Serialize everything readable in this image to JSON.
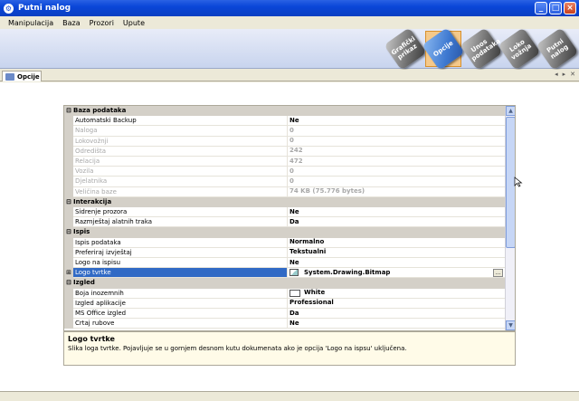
{
  "window": {
    "title": "Putni nalog"
  },
  "menu": [
    "Manipulacija",
    "Baza",
    "Prozori",
    "Upute"
  ],
  "toolbar": {
    "buttons": [
      {
        "label": "Grafički prikaz",
        "icon": "chart-icon",
        "active": false
      },
      {
        "label": "Opcije",
        "icon": "options-icon",
        "active": true
      },
      {
        "label": "Unos podataka",
        "icon": "data-entry-icon",
        "active": false
      },
      {
        "label": "Loko vožnja",
        "icon": "local-drive-icon",
        "active": false
      },
      {
        "label": "Putni nalog",
        "icon": "travel-order-icon",
        "active": false
      }
    ]
  },
  "doc_tab": {
    "label": "Opcije"
  },
  "grid": {
    "rows": [
      {
        "kind": "cat",
        "name": "Baza podataka",
        "expander": "⊟"
      },
      {
        "kind": "prop",
        "name": "Automatski Backup",
        "value": "Ne"
      },
      {
        "kind": "dis",
        "name": "Naloga",
        "value": "0"
      },
      {
        "kind": "dis",
        "name": "Lokovožnji",
        "value": "0"
      },
      {
        "kind": "dis",
        "name": "Odredišta",
        "value": "242"
      },
      {
        "kind": "dis",
        "name": "Relacija",
        "value": "472"
      },
      {
        "kind": "dis",
        "name": "Vozila",
        "value": "0"
      },
      {
        "kind": "dis",
        "name": "Djelatnika",
        "value": "0"
      },
      {
        "kind": "dis",
        "name": "Veličina baze",
        "value": "74 KB (75.776 bytes)"
      },
      {
        "kind": "cat",
        "name": "Interakcija",
        "expander": "⊟"
      },
      {
        "kind": "prop",
        "name": "Sidrenje prozora",
        "value": "Ne"
      },
      {
        "kind": "prop",
        "name": "Razmještaj alatnih traka",
        "value": "Da"
      },
      {
        "kind": "cat",
        "name": "Ispis",
        "expander": "⊟"
      },
      {
        "kind": "prop",
        "name": "Ispis podataka",
        "value": "Normalno"
      },
      {
        "kind": "prop",
        "name": "Preferiraj izvještaj",
        "value": "Tekstualni"
      },
      {
        "kind": "prop",
        "name": "Logo na ispisu",
        "value": "Ne"
      },
      {
        "kind": "sel",
        "name": "Logo tvrtke",
        "value": "System.Drawing.Bitmap",
        "expander": "⊞",
        "ellipsis": "..."
      },
      {
        "kind": "cat",
        "name": "Izgled",
        "expander": "⊟"
      },
      {
        "kind": "color",
        "name": "Boja inozemnih",
        "value": "White",
        "swatch_color": "#ffffff"
      },
      {
        "kind": "prop",
        "name": "Izgled aplikacije",
        "value": "Professional"
      },
      {
        "kind": "prop",
        "name": "MS Office izgled",
        "value": "Da"
      },
      {
        "kind": "prop",
        "name": "Crtaj rubove",
        "value": "Ne"
      }
    ]
  },
  "description": {
    "title": "Logo tvrtke",
    "text": "Slika loga tvrtke. Pojavljuje se u gornjem desnom kutu dokumenata ako je opcija 'Logo na ispsu' uključena."
  },
  "colors": {
    "titlebar": "#0a46d8",
    "selection": "#316ac5",
    "category_bg": "#d4d0c8",
    "active_tool": "#f5c98a"
  }
}
